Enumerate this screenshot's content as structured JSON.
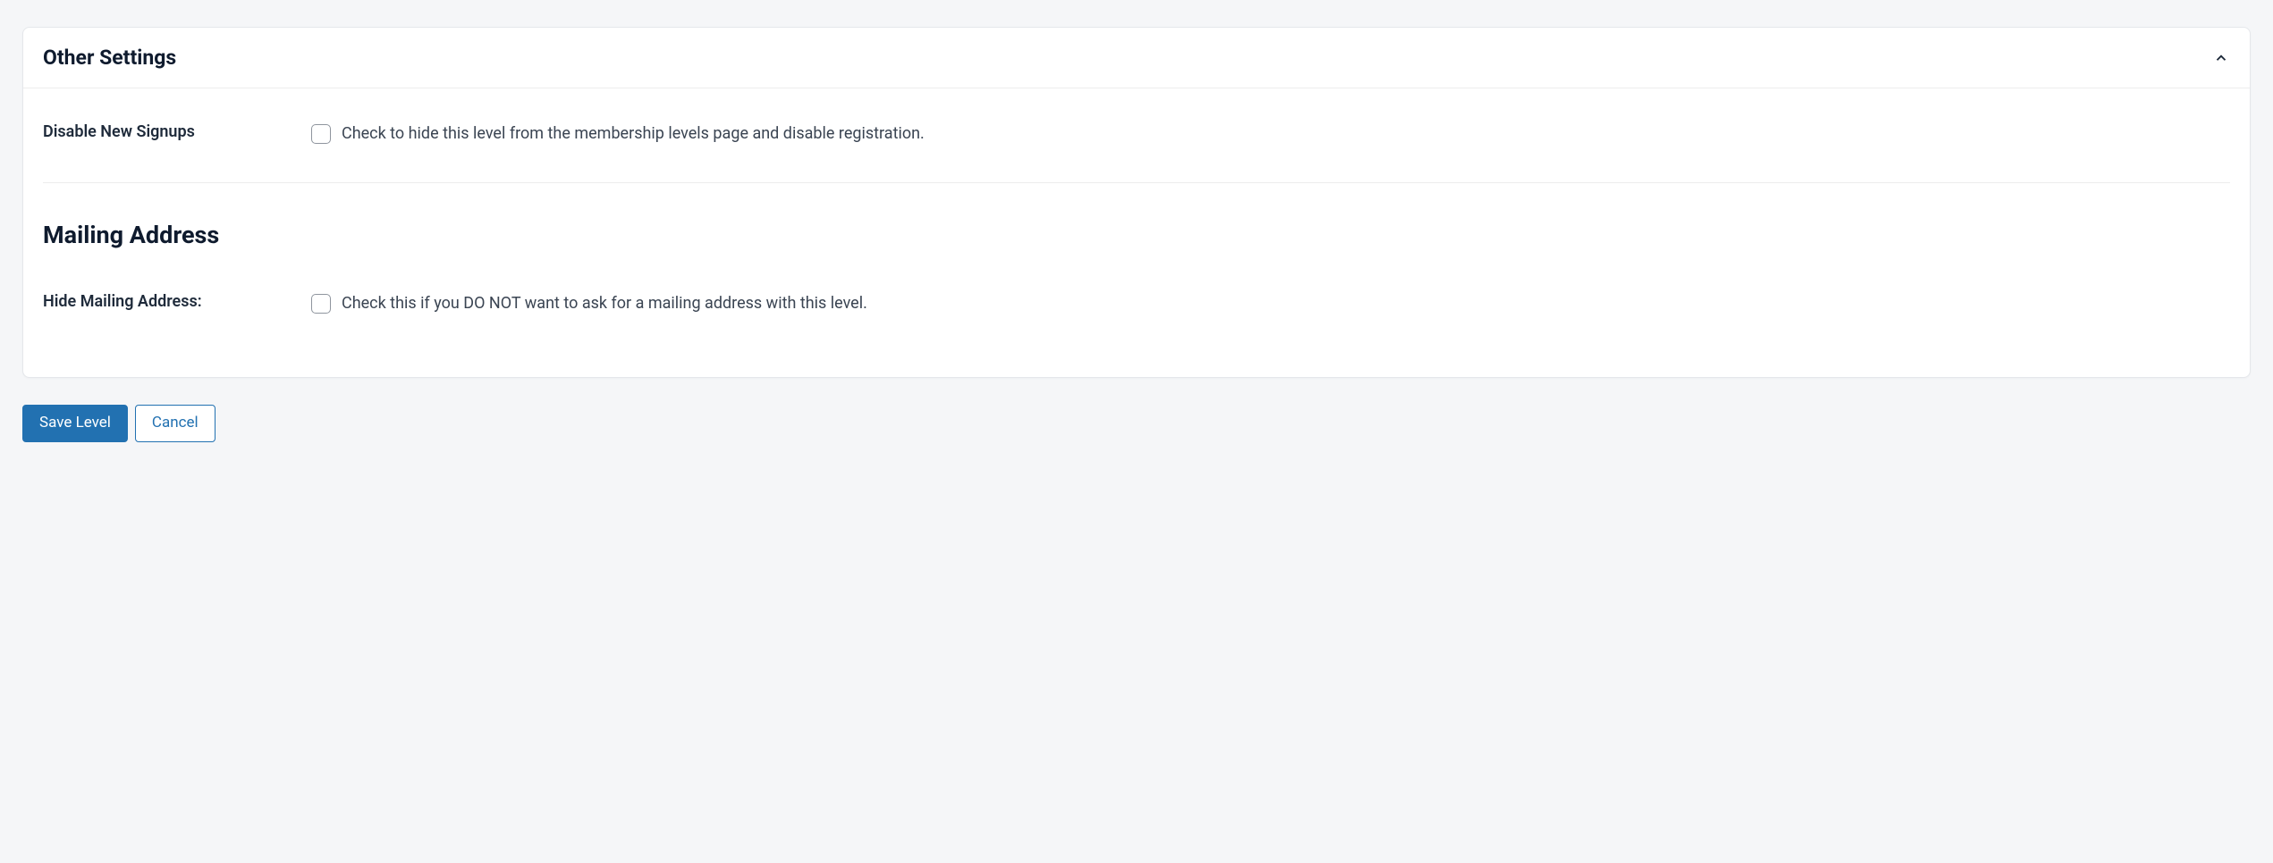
{
  "panel": {
    "title": "Other Settings"
  },
  "settings": {
    "disable_signups": {
      "label": "Disable New Signups",
      "description": "Check to hide this level from the membership levels page and disable registration."
    },
    "mailing_address_section": {
      "title": "Mailing Address"
    },
    "hide_mailing": {
      "label": "Hide Mailing Address:",
      "description": "Check this if you DO NOT want to ask for a mailing address with this level."
    }
  },
  "buttons": {
    "save": "Save Level",
    "cancel": "Cancel"
  }
}
